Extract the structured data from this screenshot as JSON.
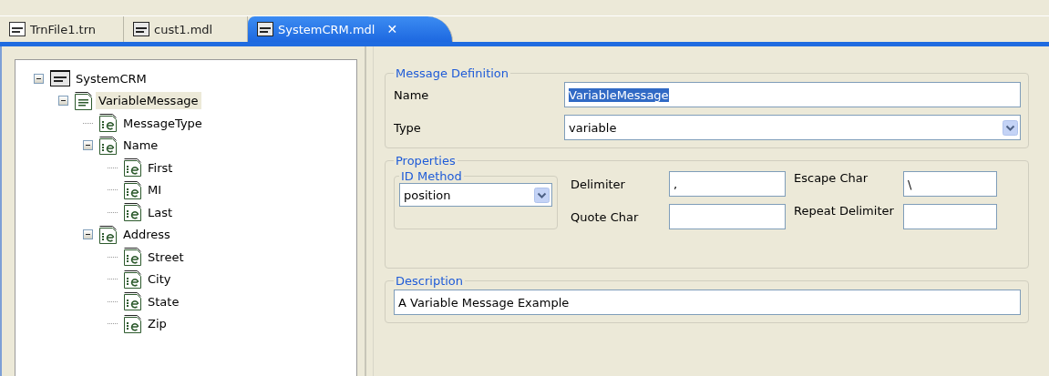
{
  "tabs": [
    {
      "label": "TrnFile1.trn",
      "kind": "trn",
      "selected": false
    },
    {
      "label": "cust1.mdl",
      "kind": "mdl",
      "selected": false
    },
    {
      "label": "SystemCRM.mdl",
      "kind": "mdl",
      "selected": true,
      "close": "✕"
    }
  ],
  "tree": [
    {
      "label": "SystemCRM",
      "kind": "model",
      "expanded": true,
      "selected": false,
      "children": [
        {
          "label": "VariableMessage",
          "kind": "message",
          "expanded": true,
          "selected": true,
          "children": [
            {
              "label": "MessageType",
              "kind": "element",
              "selected": false
            },
            {
              "label": "Name",
              "kind": "element",
              "expanded": true,
              "selected": false,
              "children": [
                {
                  "label": "First",
                  "kind": "element",
                  "selected": false
                },
                {
                  "label": "MI",
                  "kind": "element",
                  "selected": false
                },
                {
                  "label": "Last",
                  "kind": "element",
                  "selected": false
                }
              ]
            },
            {
              "label": "Address",
              "kind": "element",
              "expanded": true,
              "selected": false,
              "children": [
                {
                  "label": "Street",
                  "kind": "element",
                  "selected": false
                },
                {
                  "label": "City",
                  "kind": "element",
                  "selected": false
                },
                {
                  "label": "State",
                  "kind": "element",
                  "selected": false
                },
                {
                  "label": "Zip",
                  "kind": "element",
                  "selected": false
                }
              ]
            }
          ]
        }
      ]
    }
  ],
  "message_definition": {
    "title": "Message Definition",
    "name_label": "Name",
    "name_value": "VariableMessage",
    "name_text_selected": true,
    "type_label": "Type",
    "type_value": "variable"
  },
  "properties": {
    "title": "Properties",
    "id_method_title": "ID Method",
    "id_method_value": "position",
    "delimiter_label": "Delimiter",
    "delimiter_value": ",",
    "quote_char_label": "Quote Char",
    "escape_char_label": "Escape Char",
    "escape_char_value": "\\",
    "repeat_delimiter_label": "Repeat Delimiter"
  },
  "description": {
    "title": "Description",
    "value": "A Variable Message Example"
  }
}
